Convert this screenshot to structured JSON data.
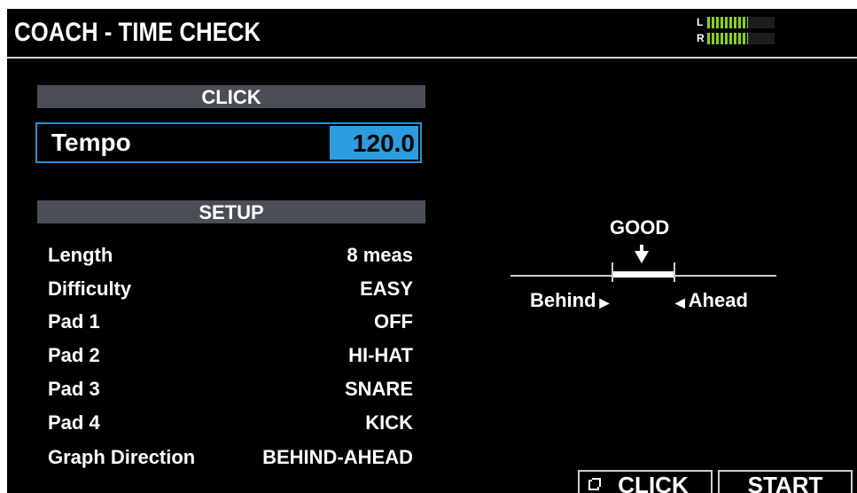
{
  "header": {
    "title": "COACH - TIME CHECK",
    "meter": {
      "left_label": "L",
      "right_label": "R",
      "left_level": 0.6,
      "right_level": 0.6
    }
  },
  "click_section": {
    "header": "CLICK",
    "tempo_label": "Tempo",
    "tempo_value": "120.0"
  },
  "setup_section": {
    "header": "SETUP",
    "params": [
      {
        "label": "Length",
        "value": "8 meas"
      },
      {
        "label": "Difficulty",
        "value": "EASY"
      },
      {
        "label": "Pad 1",
        "value": "OFF"
      },
      {
        "label": "Pad 2",
        "value": "HI-HAT"
      },
      {
        "label": "Pad 3",
        "value": "SNARE"
      },
      {
        "label": "Pad 4",
        "value": "KICK"
      },
      {
        "label": "Graph Direction",
        "value": "BEHIND-AHEAD"
      }
    ]
  },
  "timing_graph": {
    "status": "GOOD",
    "behind_label": "Behind",
    "ahead_label": "Ahead"
  },
  "buttons": {
    "click_label": "CLICK",
    "start_label": "START"
  },
  "colors": {
    "background": "#000000",
    "section_header": "#4a4e55",
    "accent": "#2b9ddf",
    "meter": "#8fd400"
  }
}
